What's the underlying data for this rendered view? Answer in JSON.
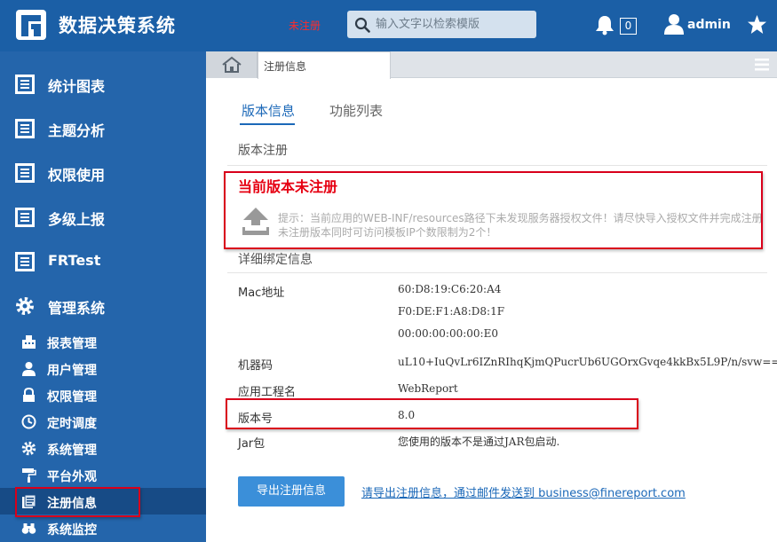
{
  "header": {
    "app_title": "数据决策系统",
    "unregistered_label": "未注册",
    "search_placeholder": "输入文字以检索模版",
    "notification_count": "0",
    "username": "admin"
  },
  "sidebar": {
    "items": [
      {
        "label": "统计图表",
        "icon": "report-icon"
      },
      {
        "label": "主题分析",
        "icon": "report-icon"
      },
      {
        "label": "权限使用",
        "icon": "report-icon"
      },
      {
        "label": "多级上报",
        "icon": "report-icon"
      },
      {
        "label": "FRTest",
        "icon": "report-icon"
      },
      {
        "label": "管理系统",
        "icon": "gear-icon"
      }
    ],
    "sub_items": [
      {
        "label": "报表管理",
        "icon": "building-icon"
      },
      {
        "label": "用户管理",
        "icon": "user-icon"
      },
      {
        "label": "权限管理",
        "icon": "lock-icon"
      },
      {
        "label": "定时调度",
        "icon": "clock-icon"
      },
      {
        "label": "系统管理",
        "icon": "cog-icon"
      },
      {
        "label": "平台外观",
        "icon": "paint-roller-icon"
      },
      {
        "label": "注册信息",
        "icon": "register-icon",
        "active": true
      },
      {
        "label": "系统监控",
        "icon": "binoculars-icon"
      }
    ]
  },
  "tabs": {
    "open_tab": "注册信息"
  },
  "content": {
    "subtabs": [
      "版本信息",
      "功能列表"
    ],
    "version_section_title": "版本注册",
    "registration_status": "当前版本未注册",
    "tip_line1": "提示：当前应用的WEB-INF/resources路径下未发现服务器授权文件！请尽快导入授权文件并完成注册",
    "tip_line2": "未注册版本同时可访问模板IP个数限制为2个！",
    "details_section_title": "详细绑定信息",
    "mac_label": "Mac地址",
    "mac_values": [
      "60:D8:19:C6:20:A4",
      "F0:DE:F1:A8:D8:1F",
      "00:00:00:00:00:E0"
    ],
    "machine_code_label": "机器码",
    "machine_code_value": "uL10+IuQvLr6IZnRIhqKjmQPucrUb6UGOrxGvqe4kkBx5L9P/n/svw==",
    "app_name_label": "应用工程名",
    "app_name_value": "WebReport",
    "version_label": "版本号",
    "version_value": "8.0",
    "jar_label": "Jar包",
    "jar_value": "您使用的版本不是通过JAR包启动.",
    "export_button": "导出注册信息",
    "export_link": "请导出注册信息，通过邮件发送到 business@finereport.com"
  },
  "colors": {
    "header_bg": "#1b5fa6",
    "sidebar_bg": "#2465ab",
    "accent": "#1b68b8",
    "warning": "#e60012"
  }
}
